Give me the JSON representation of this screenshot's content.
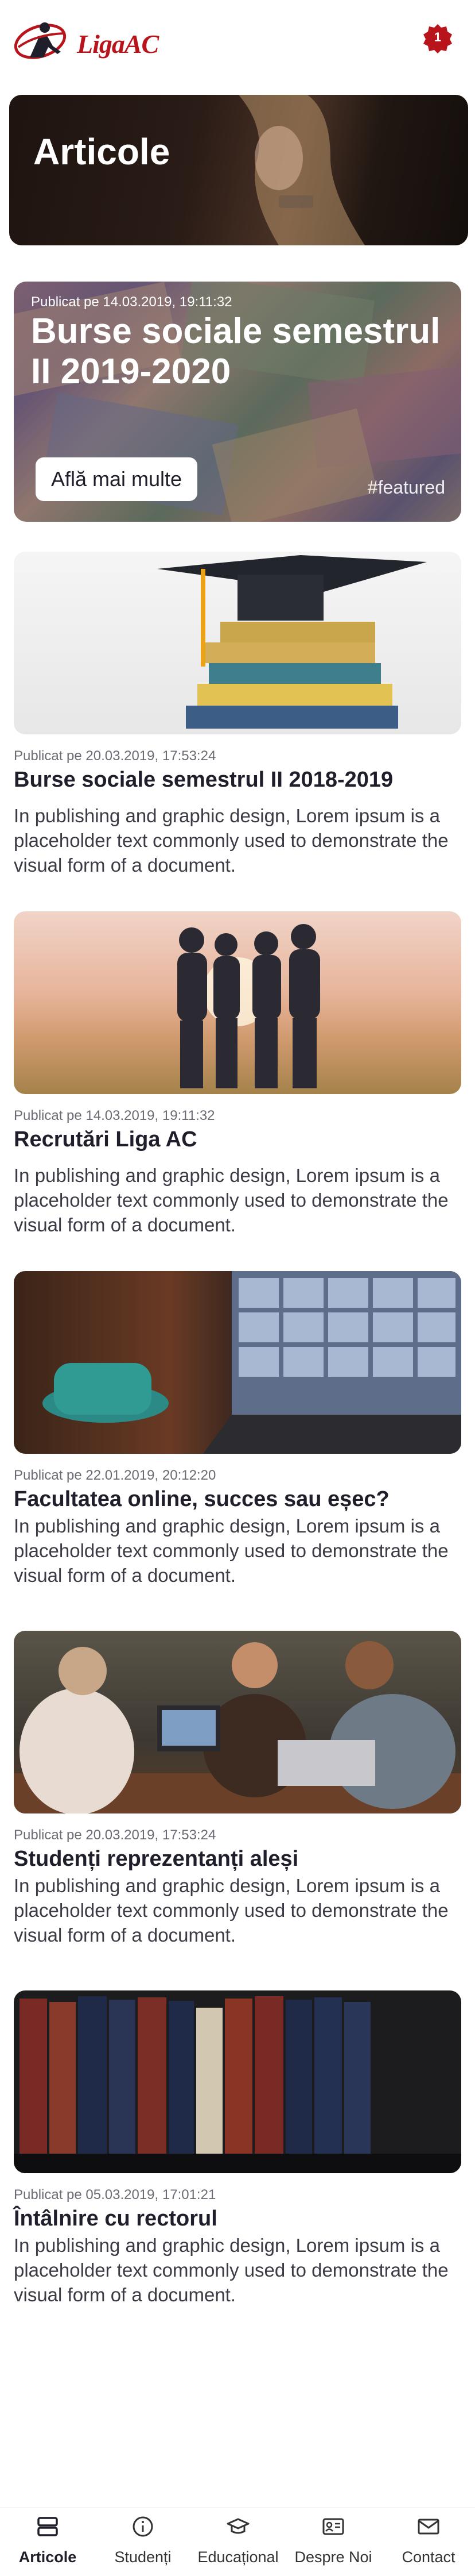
{
  "header": {
    "logo_text": "LigaAC",
    "notification_count": "1"
  },
  "hero": {
    "title": "Articole"
  },
  "featured": {
    "date": "Publicat pe 14.03.2019, 19:11:32",
    "title": "Burse sociale semestrul II 2019-2020",
    "button_label": "Află mai multe",
    "tag": "#featured"
  },
  "articles": [
    {
      "date": "Publicat pe 20.03.2019, 17:53:24",
      "title": "Burse sociale semestrul II 2018-2019",
      "description": "In publishing and graphic design, Lorem ipsum is a placeholder text commonly used to demonstrate the visual form of a document."
    },
    {
      "date": "Publicat pe 14.03.2019, 19:11:32",
      "title": "Recrutări Liga AC",
      "description": "In publishing and graphic design, Lorem ipsum is a placeholder text commonly used to demonstrate the visual form of a document."
    },
    {
      "date": "Publicat pe 22.01.2019, 20:12:20",
      "title": "Facultatea online, succes sau eșec?",
      "description": "In publishing and graphic design, Lorem ipsum is a placeholder text commonly used to demonstrate the visual form of a document."
    },
    {
      "date": "Publicat pe 20.03.2019, 17:53:24",
      "title": "Studenți reprezentanți aleși",
      "description": "In publishing and graphic design, Lorem ipsum is a placeholder text commonly used to demonstrate the visual form of a document."
    },
    {
      "date": "Publicat pe 05.03.2019, 17:01:21",
      "title": "Întâlnire cu rectorul",
      "description": "In publishing and graphic design, Lorem ipsum is a placeholder text commonly used to demonstrate the visual form of a document."
    }
  ],
  "nav": [
    {
      "label": "Articole",
      "icon": "articles-icon",
      "active": true
    },
    {
      "label": "Studenți",
      "icon": "info-icon",
      "active": false
    },
    {
      "label": "Educațional",
      "icon": "graduation-cap-icon",
      "active": false
    },
    {
      "label": "Despre Noi",
      "icon": "id-card-icon",
      "active": false
    },
    {
      "label": "Contact",
      "icon": "mail-icon",
      "active": false
    }
  ],
  "colors": {
    "brand": "#b8141c",
    "text": "#1f1f2b",
    "muted": "#6b6b75"
  }
}
